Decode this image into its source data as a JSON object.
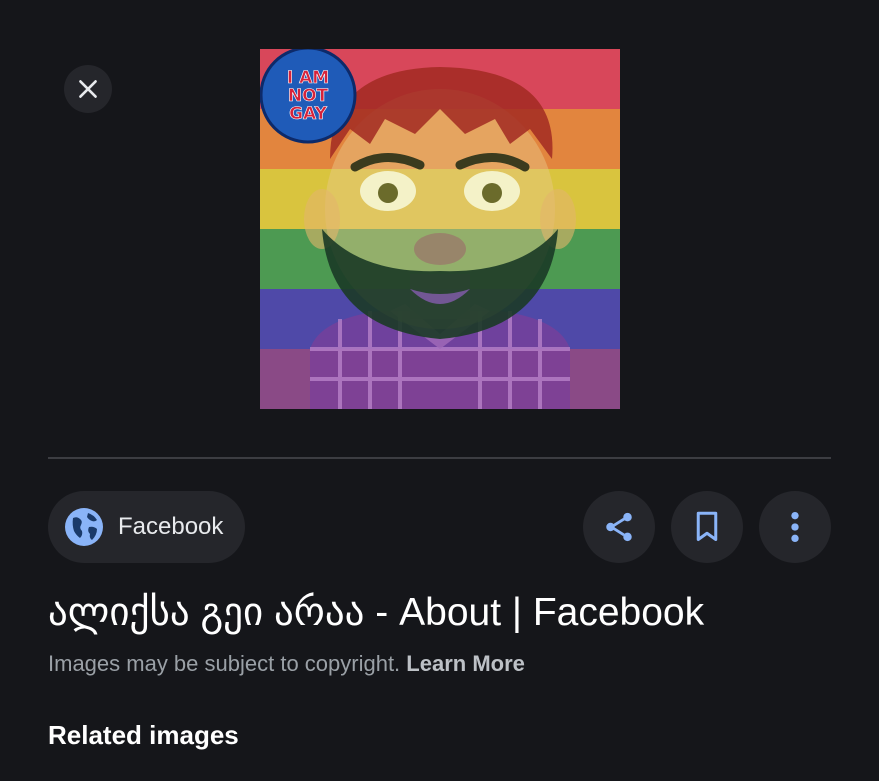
{
  "viewer": {
    "close_icon": "close-icon",
    "preview_badge_lines": [
      "I AM",
      "NOT",
      "GAY"
    ]
  },
  "source": {
    "label": "Facebook",
    "icon": "globe-icon"
  },
  "actions": {
    "share_icon": "share-icon",
    "save_icon": "bookmark-icon",
    "more_icon": "more-vert-icon"
  },
  "result": {
    "title": "ალიქსა გეი არაა - About | Facebook",
    "copyright_text": "Images may be subject to copyright.",
    "learn_more": "Learn More"
  },
  "related": {
    "heading": "Related images"
  },
  "colors": {
    "background": "#15161a",
    "chip": "#25262b",
    "accent": "#8ab4f8"
  }
}
